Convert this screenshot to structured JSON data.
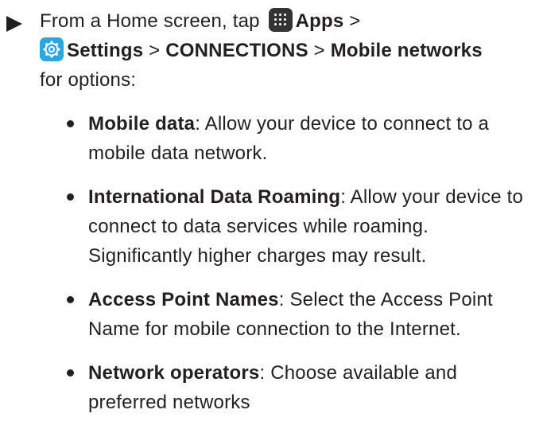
{
  "step": {
    "t1": "From a Home screen, tap",
    "apps": "Apps",
    "sep1": " >",
    "settings": "Settings",
    "sep2": " > ",
    "connections": "CONNECTIONS",
    "sep3": " > ",
    "mobile_networks": "Mobile networks",
    "t2": " for options:"
  },
  "bullets": [
    {
      "term": "Mobile data",
      "desc": ": Allow your device to connect to a mobile data network."
    },
    {
      "term": "International Data Roaming",
      "desc": ": Allow your device to connect to data services while roaming. Significantly higher charges may result."
    },
    {
      "term": "Access Point Names",
      "desc": ": Select the Access Point Name for mobile connection to the Internet."
    },
    {
      "term": "Network operators",
      "desc": ": Choose available and preferred networks"
    }
  ],
  "colors": {
    "text": "#231f20",
    "apps_icon": "#333333",
    "settings_icon": "#2aa7e1"
  },
  "icons": {
    "arrow": "triangle-right-icon",
    "apps": "apps-grid-icon",
    "settings": "settings-gear-icon"
  }
}
